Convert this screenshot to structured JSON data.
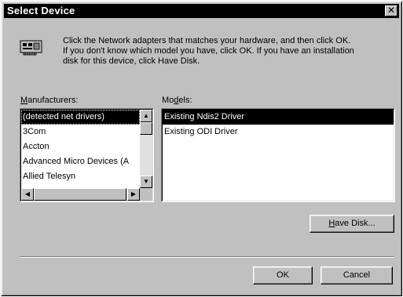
{
  "window": {
    "title": "Select Device",
    "close_glyph": "✕"
  },
  "intro": {
    "lines": [
      "Click the Network adapters that matches your hardware, and then click OK.",
      "If you don't know which model you have, click OK. If you have an installation",
      "disk for this device, click Have Disk."
    ],
    "icon": "network-adapter-icon"
  },
  "manufacturers": {
    "label_mnemonic": "M",
    "label_rest": "anufacturers:",
    "items": [
      "(detected net drivers)",
      "3Com",
      "Accton",
      "Advanced Micro Devices (A",
      "Allied Telesyn"
    ],
    "selected_index": 0
  },
  "models": {
    "label_pre": "Mo",
    "label_mnemonic": "d",
    "label_rest": "els:",
    "items": [
      "Existing Ndis2 Driver",
      "Existing ODI Driver"
    ],
    "selected_index": 0
  },
  "buttons": {
    "have_disk_mnemonic": "H",
    "have_disk_rest": "ave Disk...",
    "ok": "OK",
    "cancel": "Cancel"
  },
  "scroll_glyphs": {
    "up": "▲",
    "down": "▼",
    "left": "◀",
    "right": "▶"
  },
  "colors": {
    "face": "#c0c0c0",
    "title_bar": "#000000",
    "selection": "#000000",
    "list_bg": "#ffffff"
  }
}
